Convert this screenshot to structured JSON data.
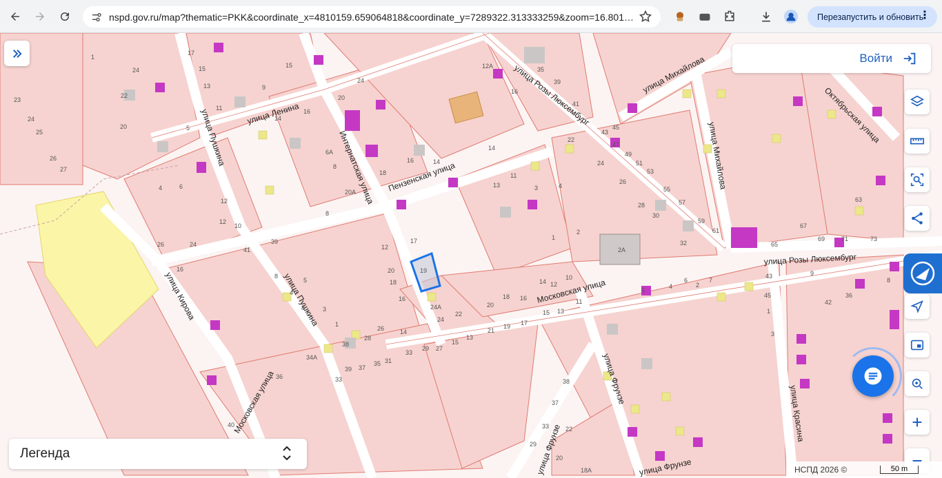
{
  "browser": {
    "url": "nspd.gov.ru/map?thematic=PKK&coordinate_x=4810159.659064818&coordinate_y=7289322.313333259&zoom=16.801…",
    "relaunch_label": "Перезапустить и обновить",
    "icons": [
      "back-icon",
      "forward-icon",
      "reload-icon",
      "site-info-icon",
      "star-icon",
      "extension-icon",
      "puzzle-icon",
      "download-icon",
      "profile-icon",
      "menu-icon"
    ]
  },
  "map": {
    "login_label": "Войти",
    "legend_label": "Легенда",
    "footer_text": "НСПД 2026 ©",
    "scale_label": "50 m",
    "streets": [
      "улица Ленина",
      "улица Пушкина",
      "Интернатская улица",
      "Пензенская улица",
      "улица Розы Люксембург",
      "улица Михайлова",
      "Октябрьская улица",
      "улица Кирова",
      "улица Пушкина",
      "Московская улица",
      "улица Розы Люксембург",
      "улица Фрунзе",
      "улица Михайлова",
      "улица Красина",
      "Московская улица",
      "улица Фрунзе",
      "улица Фрунзе"
    ],
    "numbers": [
      "17",
      "15",
      "13",
      "11",
      "9",
      "1",
      "24",
      "22",
      "23",
      "24",
      "25",
      "26",
      "27",
      "5",
      "20",
      "4",
      "6",
      "12",
      "10",
      "26",
      "24",
      "16",
      "41",
      "39",
      "8",
      "5",
      "4",
      "3",
      "8",
      "1",
      "38",
      "34А",
      "28",
      "26",
      "40",
      "36",
      "14",
      "16",
      "15",
      "14",
      "24",
      "20",
      "18",
      "16",
      "14",
      "13",
      "12",
      "11",
      "8",
      "6А",
      "8",
      "20А",
      "14",
      "16",
      "18",
      "20",
      "12",
      "17",
      "19",
      "20",
      "24А",
      "24",
      "22",
      "21",
      "19",
      "17",
      "18",
      "16",
      "15",
      "13",
      "14",
      "11",
      "12",
      "10",
      "1",
      "2",
      "3",
      "4",
      "33",
      "31",
      "29",
      "27",
      "15",
      "13",
      "35",
      "33",
      "37",
      "39",
      "38",
      "37",
      "33",
      "29",
      "22",
      "20",
      "18А",
      "45",
      "43",
      "47",
      "49",
      "51",
      "53",
      "55",
      "57",
      "59",
      "61",
      "63",
      "65",
      "67",
      "69",
      "71",
      "73",
      "2А",
      "32",
      "30",
      "28",
      "26",
      "24",
      "22",
      "12А",
      "16",
      "35",
      "39",
      "41",
      "43",
      "45",
      "1",
      "2",
      "3",
      "4",
      "5",
      "6",
      "7",
      "8",
      "9",
      "42",
      "36",
      "38",
      "40"
    ],
    "toolbar_icons": [
      "layers-icon",
      "ruler-icon",
      "search-area-icon",
      "share-icon",
      "locate-arrow-icon",
      "picture-in-picture-icon",
      "pin-search-icon",
      "zoom-in-icon",
      "zoom-out-icon"
    ],
    "colors": {
      "parcel_fill": "#f6d3d0",
      "parcel_line": "#e07a70",
      "building": "#c8c4c4",
      "accent_magenta": "#c438c4",
      "accent_yellow": "#ece78a",
      "selected": "#1a73e8"
    }
  }
}
